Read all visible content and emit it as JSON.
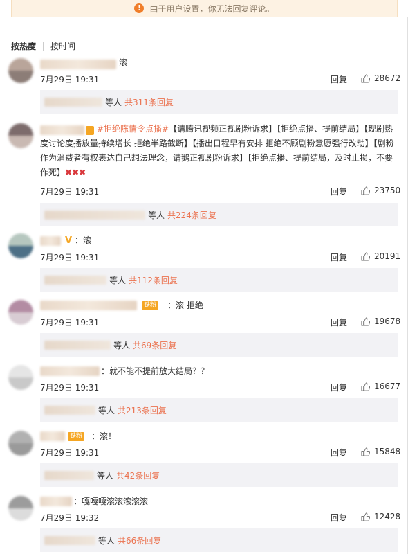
{
  "notice": {
    "text": "由于用户设置，你无法回复评论。",
    "icon": "!"
  },
  "sort": {
    "hot": "按热度",
    "time": "按时间"
  },
  "reply_label": "回复",
  "comments": [
    {
      "text": "滚",
      "date": "7月29日 19:31",
      "likes": "28672",
      "sub_who": "等人",
      "sub_count": "共311条回复"
    },
    {
      "tag": "#拒绝陈情令点播#",
      "text": "【请腾讯视频正视剧粉诉求】【拒绝点播、提前结局】【现剧热度讨论度播放量持续增长 拒绝半路截断】【播出日程早有安排 拒绝不顾剧粉意愿强行改动】【剧粉作为消费者有权表达自己想法理念，请鹅正视剧粉诉求】【拒绝点播、提前结局，及时止损，不要作死】",
      "marks": "✖✖✖",
      "date": "7月29日 19:31",
      "likes": "23750",
      "sub_who": "等人",
      "sub_count": "共224条回复"
    },
    {
      "text": "：滚",
      "date": "7月29日 19:31",
      "likes": "20191",
      "sub_who": "等人",
      "sub_count": "共112条回复"
    },
    {
      "badge": "铁粉",
      "text": "：滚 拒绝",
      "date": "7月29日 19:31",
      "likes": "19678",
      "sub_who": "等人",
      "sub_count": "共69条回复"
    },
    {
      "text": "：就不能不提前放大结局？？",
      "date": "7月29日 19:31",
      "likes": "16677",
      "sub_who": "等人",
      "sub_count": "共213条回复"
    },
    {
      "badge": "铁粉",
      "text": "：滚！",
      "date": "7月29日 19:31",
      "likes": "15848",
      "sub_who": "等人",
      "sub_count": "共42条回复"
    },
    {
      "text": "：嘎嘎嘎滚滚滚滚滚",
      "date": "7月29日 19:32",
      "likes": "12428",
      "sub_who": "等人",
      "sub_count": "共66条回复"
    }
  ]
}
